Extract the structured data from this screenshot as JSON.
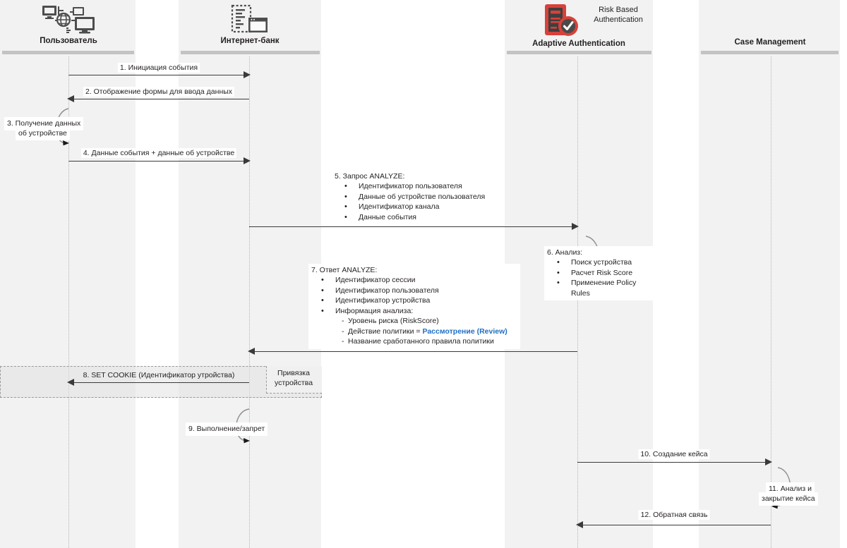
{
  "diagram": {
    "title": "Sequence diagram: Adaptive Authentication flow",
    "accent_blue": "#1f6fc4",
    "accent_red": "#d8413a",
    "band_color": "#f2f2f2",
    "line_color": "#3a3a3a"
  },
  "lifelines": [
    {
      "id": "user",
      "label": "Пользователь",
      "sublabel": "",
      "icon": "user-devices-icon"
    },
    {
      "id": "ibank",
      "label": "Интернет-банк",
      "sublabel": "",
      "icon": "browser-page-icon"
    },
    {
      "id": "adaptive",
      "label": "Adaptive Authentication",
      "sublabel": "Risk Based Authentication",
      "icon": "server-check-icon"
    },
    {
      "id": "case",
      "label": "Case Management",
      "sublabel": "",
      "icon": ""
    }
  ],
  "messages": [
    {
      "n": "1",
      "label": "1. Инициация события",
      "from": "user",
      "to": "ibank"
    },
    {
      "n": "2",
      "label": "2. Отображение формы для ввода данных",
      "from": "ibank",
      "to": "user"
    },
    {
      "n": "3",
      "label": "3. Получение данных\nоб устройстве",
      "from": "user",
      "to": "user",
      "self": true
    },
    {
      "n": "4",
      "label": "4. Данные события + данные об устройстве",
      "from": "user",
      "to": "ibank"
    },
    {
      "n": "5",
      "title": "5. Запрос ANALYZE:",
      "from": "ibank",
      "to": "adaptive",
      "bullets": [
        "Идентификатор пользователя",
        "Данные об устройстве пользователя",
        "Идентификатор канала",
        "Данные события"
      ]
    },
    {
      "n": "6",
      "title": "6. Анализ:",
      "from": "adaptive",
      "to": "adaptive",
      "self": true,
      "bullets": [
        "Поиск устройства",
        "Расчет Risk Score",
        "Применение Policy Rules"
      ]
    },
    {
      "n": "7",
      "title": "7. Ответ ANALYZE:",
      "from": "adaptive",
      "to": "ibank",
      "bullets": [
        "Идентификатор сессии",
        "Идентификатор пользователя",
        "Идентификатор устройства",
        "Информация анализа:"
      ],
      "subitems": [
        {
          "text": "Уровень риска (RiskScore)",
          "highlight": ""
        },
        {
          "text": "Действие политики = ",
          "highlight": "Рассмотрение (Review)"
        },
        {
          "text": "Название сработанного правила политики",
          "highlight": ""
        }
      ]
    },
    {
      "n": "8",
      "label": "8. SET COOKIE (Идентификатор утройства)",
      "from": "ibank",
      "to": "user"
    },
    {
      "n": "9",
      "label": "9. Выполнение/запрет",
      "from": "ibank",
      "to": "ibank",
      "self": true
    },
    {
      "n": "10",
      "label": "10. Создание кейса",
      "from": "adaptive",
      "to": "case"
    },
    {
      "n": "11",
      "label": "11. Анализ и\nзакрытие кейса",
      "from": "case",
      "to": "case",
      "self": true
    },
    {
      "n": "12",
      "label": "12. Обратная связь",
      "from": "case",
      "to": "adaptive"
    }
  ],
  "fragment": {
    "tag": "Привязка\nустройства",
    "tag_line1": "Привязка",
    "tag_line2": "устройства"
  },
  "labels": {
    "m1": "1. Инициация события",
    "m2": "2. Отображение формы для ввода данных",
    "m3_l1": "3. Получение данных",
    "m3_l2": "об устройстве",
    "m4": "4. Данные события + данные об устройстве",
    "m5_title": "5. Запрос ANALYZE:",
    "m5_b1": "Идентификатор пользователя",
    "m5_b2": "Данные об устройстве пользователя",
    "m5_b3": "Идентификатор канала",
    "m5_b4": "Данные события",
    "m6_title": "6. Анализ:",
    "m6_b1": "Поиск устройства",
    "m6_b2": "Расчет Risk Score",
    "m6_b3": "Применение Policy Rules",
    "m7_title": "7. Ответ ANALYZE:",
    "m7_b1": "Идентификатор сессии",
    "m7_b2": "Идентификатор пользователя",
    "m7_b3": "Идентификатор устройства",
    "m7_b4": "Информация анализа:",
    "m7_s1": "Уровень риска (RiskScore)",
    "m7_s2_pre": "Действие политики = ",
    "m7_s2_hl": "Рассмотрение (Review)",
    "m7_s3": "Название сработанного правила политики",
    "m8": "8. SET COOKIE (Идентификатор утройства)",
    "m9": "9. Выполнение/запрет",
    "m10": "10. Создание кейса",
    "m11_l1": "11. Анализ и",
    "m11_l2": "закрытие кейса",
    "m12": "12. Обратная связь",
    "frag_l1": "Привязка",
    "frag_l2": "устройства",
    "hdr_user": "Пользователь",
    "hdr_ibank": "Интернет-банк",
    "hdr_adaptive": "Adaptive Authentication",
    "hdr_rba_l1": "Risk Based",
    "hdr_rba_l2": "Authentication",
    "hdr_case": "Case Management"
  }
}
